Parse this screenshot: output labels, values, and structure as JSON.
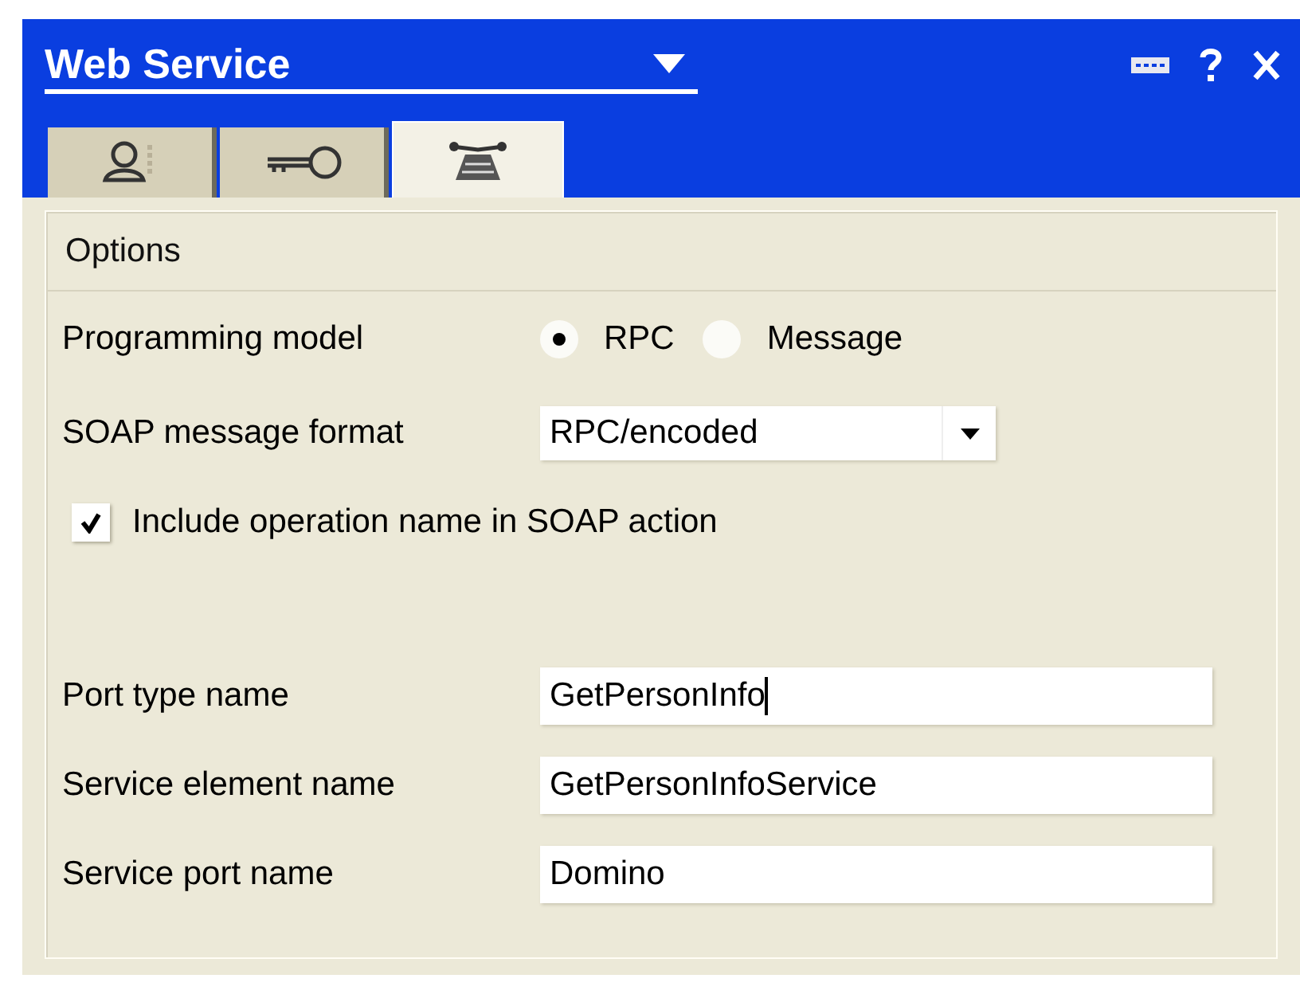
{
  "window": {
    "title": "Web Service"
  },
  "tabs": [
    {
      "selected": false
    },
    {
      "selected": false
    },
    {
      "selected": true
    }
  ],
  "section": {
    "title": "Options"
  },
  "programming_model": {
    "label": "Programming model",
    "options": [
      {
        "label": "RPC",
        "selected": true
      },
      {
        "label": "Message",
        "selected": false
      }
    ]
  },
  "soap_format": {
    "label": "SOAP message format",
    "value": "RPC/encoded"
  },
  "include_operation": {
    "label": "Include operation name in SOAP action",
    "checked": true
  },
  "fields": [
    {
      "label": "Port type name",
      "value": "GetPersonInfo",
      "focused": true
    },
    {
      "label": "Service element name",
      "value": "GetPersonInfoService",
      "focused": false
    },
    {
      "label": "Service port name",
      "value": "Domino",
      "focused": false
    }
  ]
}
